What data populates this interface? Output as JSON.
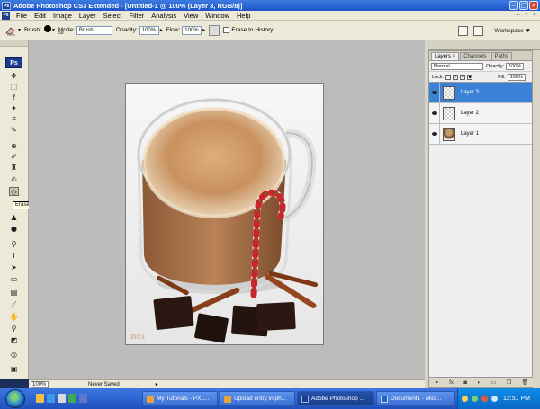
{
  "window": {
    "title": "Adobe Photoshop CS3 Extended - [Untitled-1 @ 100% (Layer 3, RGB/8)]"
  },
  "app_badge": "Ps",
  "menu": [
    "File",
    "Edit",
    "Image",
    "Layer",
    "Select",
    "Filter",
    "Analysis",
    "View",
    "Window",
    "Help"
  ],
  "options": {
    "brush_label": "Brush:",
    "brush_size": "59",
    "mode_label": "Mode:",
    "mode_value": "Brush",
    "opacity_label": "Opacity:",
    "opacity_value": "100%",
    "flow_label": "Flow:",
    "flow_value": "100%",
    "erase_history_label": "Erase to History",
    "workspace_label": "Workspace ▼"
  },
  "tooltip": "Eraser Tool (E)",
  "status": {
    "zoom": "100%",
    "doc_status": "Never Saved"
  },
  "layers_panel": {
    "tabs": [
      "Layers ×",
      "Channels",
      "Paths"
    ],
    "blend_mode": "Normal",
    "opacity_label": "Opacity:",
    "opacity_value": "100%",
    "lock_label": "Lock:",
    "fill_label": "Fill:",
    "fill_value": "100%",
    "layers": [
      {
        "name": "Layer 3",
        "selected": true,
        "thumb": "transparent"
      },
      {
        "name": "Layer 2",
        "selected": false,
        "thumb": "transparent"
      },
      {
        "name": "Layer 1",
        "selected": false,
        "thumb": "photo"
      }
    ],
    "footer_icons": [
      "link-icon",
      "fx-icon",
      "mask-icon",
      "adjustment-icon",
      "folder-icon",
      "new-layer-icon",
      "trash-icon"
    ]
  },
  "canvas": {
    "signature": "RICA"
  },
  "taskbar": {
    "buttons": [
      {
        "label": "My Tutorials - PXL...",
        "color": "#e8a33b",
        "active": false
      },
      {
        "label": "Upload entry in ph...",
        "color": "#e8a33b",
        "active": false
      },
      {
        "label": "Adobe Photoshop ...",
        "color": "#1c3d8f",
        "active": true
      },
      {
        "label": "Document1 - Micr...",
        "color": "#2b5fbd",
        "active": false
      }
    ],
    "clock": "12:51 PM"
  }
}
